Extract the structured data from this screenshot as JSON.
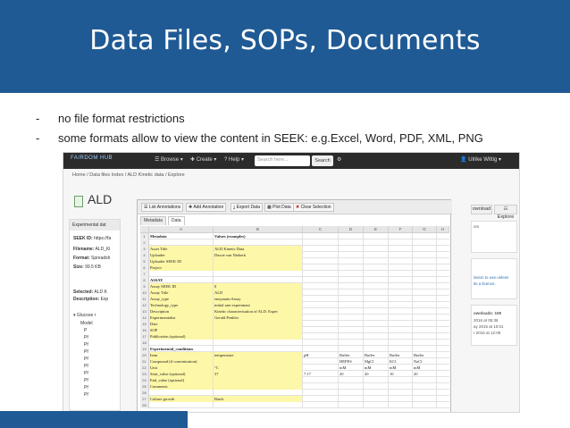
{
  "slide": {
    "title": "Data Files, SOPs, Documents",
    "bullets": [
      {
        "dash": "-",
        "text": "no file format restrictions"
      },
      {
        "dash": "-",
        "text": "some formats allow to view the content in SEEK: e.g.Excel, Word, PDF, XML, PNG"
      }
    ]
  },
  "screenshot": {
    "navbar": {
      "logo": "FAIRDOM HUB",
      "browse": "Browse",
      "create": "Create",
      "help": "Help",
      "search_placeholder": "Search here...",
      "search_button": "Search",
      "user": "Ulrike Wittig"
    },
    "breadcrumb": "Home  /  Data files Index  /  ALD Kinetic data  /  Explore",
    "heading": "ALD",
    "left_panel": {
      "header": "Experimental dat",
      "lines": [
        {
          "label": "SEEK ID:",
          "value": "https://fa"
        },
        {
          "label": "Filename:",
          "value": "ALD_Ki"
        },
        {
          "label": "Format:",
          "value": "Spreadsh"
        },
        {
          "label": "Size:",
          "value": "99.5 KB"
        },
        {
          "label": "Selected:",
          "value": "ALD K"
        },
        {
          "label": "Description:",
          "value": "Exp"
        }
      ],
      "tree_root": "Glucose r",
      "tree_items": [
        "Model",
        "P",
        "Pf",
        "Pf",
        "Pf",
        "Pf",
        "Pf",
        "Pf",
        "Pf",
        "Pf",
        "Pf"
      ]
    },
    "right_panel": {
      "download": "ownload",
      "explore": "Explore",
      "creators": "ors",
      "license_1": "ission to use unless",
      "license_2": "its a licence.",
      "downloads": "ownloads: 109",
      "date_1": "2016 at 05:36",
      "date_2": "ay 2015 at 10:01",
      "date_3": "r 2016 at 12:09"
    },
    "sheet": {
      "toolbar": [
        "List Annotations",
        "Add Annotation",
        "Export Data",
        "Plot Data",
        "Clear Selection"
      ],
      "tabs": [
        "Metadata",
        "Data"
      ],
      "active_tab": "Data",
      "columns": [
        "A",
        "B",
        "C",
        "D",
        "E",
        "F",
        "G",
        "H",
        "I"
      ],
      "rows": [
        {
          "n": "1",
          "a": "Metadata",
          "b": "Values (examples)",
          "c": "",
          "d": "",
          "e": "",
          "f": "",
          "g": "",
          "bold": true,
          "hl": false
        },
        {
          "n": "2",
          "a": "",
          "b": "",
          "c": "",
          "d": "",
          "e": "",
          "f": "",
          "g": "",
          "bold": false,
          "hl": false
        },
        {
          "n": "3",
          "a": "Asset Title",
          "b": "ALD Kinetic Data",
          "c": "",
          "d": "",
          "e": "",
          "f": "",
          "g": "",
          "bold": false,
          "hl": true
        },
        {
          "n": "4",
          "a": "Uploader",
          "b": "Dawie van Niekerk",
          "c": "",
          "d": "",
          "e": "",
          "f": "",
          "g": "",
          "bold": false,
          "hl": true
        },
        {
          "n": "5",
          "a": "Uploader SEEK ID",
          "b": "",
          "c": "",
          "d": "",
          "e": "",
          "f": "",
          "g": "",
          "bold": false,
          "hl": true
        },
        {
          "n": "6",
          "a": "Project",
          "b": "",
          "c": "",
          "d": "",
          "e": "",
          "f": "",
          "g": "",
          "bold": false,
          "hl": true
        },
        {
          "n": "7",
          "a": "",
          "b": "",
          "c": "",
          "d": "",
          "e": "",
          "f": "",
          "g": "",
          "bold": false,
          "hl": false
        },
        {
          "n": "8",
          "a": "ASSAY",
          "b": "",
          "c": "",
          "d": "",
          "e": "",
          "f": "",
          "g": "",
          "bold": true,
          "hl": false
        },
        {
          "n": "9",
          "a": "Assay SEEK ID",
          "b": "0",
          "c": "",
          "d": "",
          "e": "",
          "f": "",
          "g": "",
          "bold": false,
          "hl": true
        },
        {
          "n": "10",
          "a": "Assay Title",
          "b": "ALD",
          "c": "",
          "d": "",
          "e": "",
          "f": "",
          "g": "",
          "bold": false,
          "hl": true
        },
        {
          "n": "11",
          "a": "Assay_type",
          "b": "enzymaticAssay",
          "c": "",
          "d": "",
          "e": "",
          "f": "",
          "g": "",
          "bold": false,
          "hl": true
        },
        {
          "n": "12",
          "a": "Technology_type",
          "b": "initial rate experiment",
          "c": "",
          "d": "",
          "e": "",
          "f": "",
          "g": "",
          "bold": false,
          "hl": true
        },
        {
          "n": "13",
          "a": "Description",
          "b": "Kinetic characterisation of ALD. Exper",
          "c": "",
          "d": "",
          "e": "",
          "f": "",
          "g": "",
          "bold": false,
          "hl": true
        },
        {
          "n": "14",
          "a": "Experimentalist",
          "b": "Gerald Penkler",
          "c": "",
          "d": "",
          "e": "",
          "f": "",
          "g": "",
          "bold": false,
          "hl": true
        },
        {
          "n": "15",
          "a": "Date",
          "b": "",
          "c": "",
          "d": "",
          "e": "",
          "f": "",
          "g": "",
          "bold": false,
          "hl": true
        },
        {
          "n": "16",
          "a": "SOP",
          "b": "",
          "c": "",
          "d": "",
          "e": "",
          "f": "",
          "g": "",
          "bold": false,
          "hl": true
        },
        {
          "n": "17",
          "a": "Publication (optional)",
          "b": "",
          "c": "",
          "d": "",
          "e": "",
          "f": "",
          "g": "",
          "bold": false,
          "hl": true
        },
        {
          "n": "18",
          "a": "",
          "b": "",
          "c": "",
          "d": "",
          "e": "",
          "f": "",
          "g": "",
          "bold": false,
          "hl": false
        },
        {
          "n": "19",
          "a": "Experimental_conditions",
          "b": "",
          "c": "",
          "d": "",
          "e": "",
          "f": "",
          "g": "",
          "bold": true,
          "hl": false
        },
        {
          "n": "20",
          "a": "Item",
          "b": "temperature",
          "c": "pH",
          "d": "Buffer",
          "e": "Buffer",
          "f": "Buffer",
          "g": "Buffer",
          "bold": false,
          "hl": true
        },
        {
          "n": "21",
          "a": "Compound (if concentration)",
          "b": "",
          "c": "",
          "d": "HEPES",
          "e": "MgCl",
          "f": "KCl",
          "g": "NaCl",
          "bold": false,
          "hl": true
        },
        {
          "n": "22",
          "a": "Unit",
          "b": "°C",
          "c": "",
          "d": "mM",
          "e": "mM",
          "f": "mM",
          "g": "mM",
          "bold": false,
          "hl": true
        },
        {
          "n": "23",
          "a": "Start_value (optional)",
          "b": "37",
          "c": "7.17",
          "d": "20",
          "e": "20",
          "f": "10",
          "g": "20",
          "bold": false,
          "hl": true
        },
        {
          "n": "24",
          "a": "End_value (optional)",
          "b": "",
          "c": "",
          "d": "",
          "e": "",
          "f": "",
          "g": "",
          "bold": false,
          "hl": true
        },
        {
          "n": "25",
          "a": "Comments",
          "b": "",
          "c": "",
          "d": "",
          "e": "",
          "f": "",
          "g": "",
          "bold": false,
          "hl": true
        },
        {
          "n": "26",
          "a": "",
          "b": "",
          "c": "",
          "d": "",
          "e": "",
          "f": "",
          "g": "",
          "bold": false,
          "hl": false
        },
        {
          "n": "27",
          "a": "Culture growth",
          "b": "Batch",
          "c": "",
          "d": "",
          "e": "",
          "f": "",
          "g": "",
          "bold": false,
          "hl": true
        },
        {
          "n": "28",
          "a": "",
          "b": "",
          "c": "",
          "d": "",
          "e": "",
          "f": "",
          "g": "",
          "bold": false,
          "hl": false
        }
      ]
    }
  },
  "colors": {
    "header": "#1f5a94",
    "highlight": "#fdf7a8",
    "navbar": "#2b2b2b"
  }
}
